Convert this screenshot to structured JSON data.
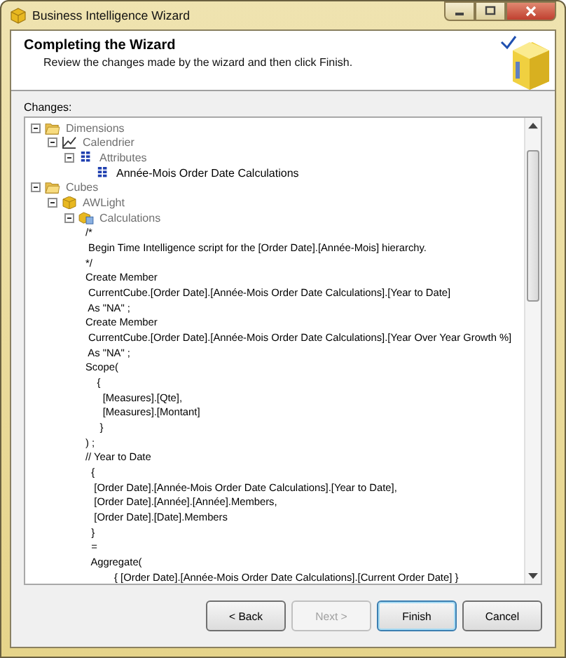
{
  "window": {
    "title": "Business Intelligence Wizard"
  },
  "header": {
    "title": "Completing the Wizard",
    "subtitle": "Review the changes made by the wizard and then click Finish."
  },
  "changes": {
    "label": "Changes:",
    "tree": [
      {
        "kind": "folder",
        "label": "Dimensions",
        "new": false,
        "expanded": true,
        "children": [
          {
            "kind": "dimension",
            "label": "Calendrier",
            "new": false,
            "expanded": true,
            "children": [
              {
                "kind": "attributes",
                "label": "Attributes",
                "new": false,
                "expanded": true,
                "children": [
                  {
                    "kind": "attributes",
                    "label": "Année-Mois Order Date Calculations",
                    "new": true
                  }
                ]
              }
            ]
          }
        ]
      },
      {
        "kind": "folder",
        "label": "Cubes",
        "new": false,
        "expanded": true,
        "children": [
          {
            "kind": "cube",
            "label": "AWLight",
            "new": false,
            "expanded": true,
            "children": [
              {
                "kind": "calculations",
                "label": "Calculations",
                "new": false,
                "expanded": true,
                "script": [
                  "/*",
                  " Begin Time Intelligence script for the [Order Date].[Année-Mois] hierarchy.",
                  "*/",
                  "Create Member",
                  " CurrentCube.[Order Date].[Année-Mois Order Date Calculations].[Year to Date]",
                  " As \"NA\" ;",
                  "Create Member",
                  " CurrentCube.[Order Date].[Année-Mois Order Date Calculations].[Year Over Year Growth %]",
                  " As \"NA\" ;",
                  "Scope(",
                  "    {",
                  "      [Measures].[Qte],",
                  "      [Measures].[Montant]",
                  "     }",
                  ") ;",
                  "// Year to Date",
                  "  {",
                  "   [Order Date].[Année-Mois Order Date Calculations].[Year to Date],",
                  "   [Order Date].[Année].[Année].Members,",
                  "   [Order Date].[Date].Members",
                  "  }",
                  "  =",
                  "  Aggregate(",
                  "          { [Order Date].[Année-Mois Order Date Calculations].[Current Order Date] }"
                ]
              }
            ]
          }
        ]
      }
    ]
  },
  "buttons": [
    {
      "label": "< Back",
      "disabled": false,
      "default": false
    },
    {
      "label": "Next >",
      "disabled": true,
      "default": false
    },
    {
      "label": "Finish",
      "disabled": false,
      "default": true
    },
    {
      "label": "Cancel",
      "disabled": false,
      "default": false
    }
  ]
}
